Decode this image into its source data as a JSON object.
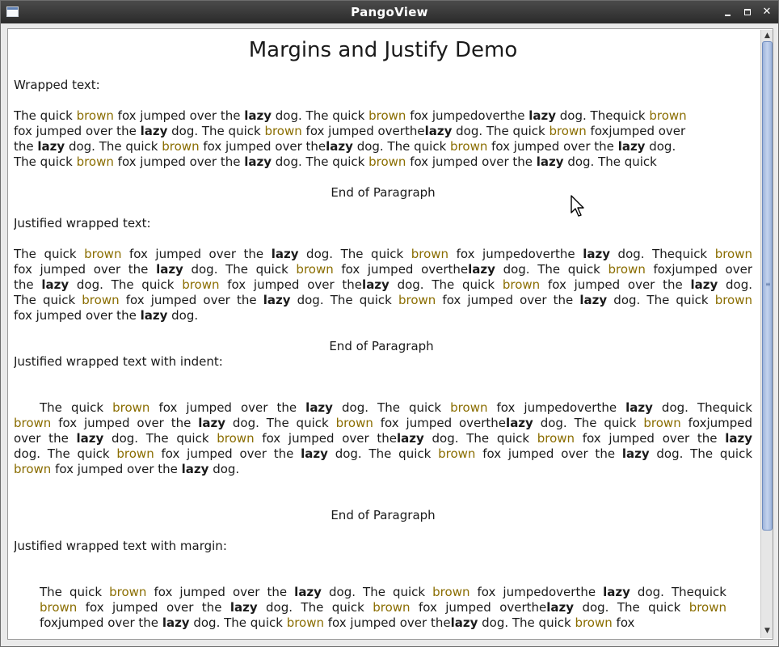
{
  "window": {
    "title": "PangoView",
    "controls": {
      "minimize": "minimize",
      "maximize": "maximize",
      "close": "close"
    }
  },
  "document": {
    "title": "Margins and Justify Demo",
    "sections": [
      {
        "label": "Wrapped text:",
        "lines": [
          [
            "The quick ",
            "brown",
            " fox jumped over the ",
            "lazy",
            " dog. The quick ",
            "brown",
            " fox jumpedoverthe ",
            "lazy",
            " dog. Thequick ",
            "brown"
          ],
          [
            "fox jumped over the ",
            "lazy",
            " dog. The quick ",
            "brown",
            " fox jumped overthe",
            "lazy",
            " dog. The quick ",
            "brown",
            " foxjumped over"
          ],
          [
            "the ",
            "lazy",
            " dog. The quick ",
            "brown",
            " fox jumped over the",
            "lazy",
            " dog. The quick ",
            "brown",
            " fox jumped over the ",
            "lazy",
            " dog."
          ],
          [
            "The quick ",
            "brown",
            " fox jumped over the ",
            "lazy",
            " dog. The quick ",
            "brown",
            " fox jumped over the ",
            "lazy",
            " dog. The quick"
          ]
        ],
        "end": "End of Paragraph"
      },
      {
        "label": "Justified wrapped text:",
        "lines": [
          [
            "The quick ",
            "brown",
            " fox jumped over the ",
            "lazy",
            " dog. The quick ",
            "brown",
            " fox jumpedoverthe ",
            "lazy",
            " dog. Thequick ",
            "brown"
          ],
          [
            "fox jumped over the ",
            "lazy",
            " dog. The quick ",
            "brown",
            " fox jumped overthe",
            "lazy",
            " dog. The quick ",
            "brown",
            " foxjumped over"
          ],
          [
            "the ",
            "lazy",
            " dog. The quick ",
            "brown",
            " fox jumped over the",
            "lazy",
            " dog. The quick ",
            "brown",
            " fox jumped over the ",
            "lazy",
            " dog."
          ],
          [
            "The quick ",
            "brown",
            " fox jumped over the ",
            "lazy",
            " dog. The quick ",
            "brown",
            " fox jumped over the ",
            "lazy",
            " dog. The quick ",
            "brown"
          ],
          [
            "fox jumped over the ",
            "lazy",
            " dog."
          ]
        ],
        "end": "End of Paragraph"
      },
      {
        "label": "Justified wrapped text with indent:",
        "lines": [
          [
            "The quick ",
            "brown",
            " fox jumped over the ",
            "lazy",
            " dog. The quick ",
            "brown",
            " fox jumpedoverthe ",
            "lazy",
            " dog. Thequick"
          ],
          [
            "brown",
            " fox jumped over the ",
            "lazy",
            " dog. The quick ",
            "brown",
            " fox jumped overthe",
            "lazy",
            " dog. The quick ",
            "brown",
            " foxjumped"
          ],
          [
            "over the ",
            "lazy",
            " dog. The quick ",
            "brown",
            " fox jumped over the",
            "lazy",
            " dog. The quick ",
            "brown",
            " fox jumped over the ",
            "lazy"
          ],
          [
            "dog. The quick ",
            "brown",
            " fox jumped over the ",
            "lazy",
            " dog. The quick ",
            "brown",
            " fox jumped over the ",
            "lazy",
            " dog. The quick"
          ],
          [
            "brown",
            " fox jumped over the ",
            "lazy",
            " dog."
          ]
        ],
        "end": "End of Paragraph"
      },
      {
        "label": "Justified wrapped text with margin:",
        "lines": [
          [
            "The quick ",
            "brown",
            " fox jumped over the ",
            "lazy",
            " dog. The quick ",
            "brown",
            " fox jumpedoverthe ",
            "lazy",
            " dog. Thequick"
          ],
          [
            "brown",
            " fox jumped over the ",
            "lazy",
            " dog. The quick ",
            "brown",
            " fox jumped overthe",
            "lazy",
            " dog. The quick ",
            "brown"
          ],
          [
            "foxjumped over the ",
            "lazy",
            " dog. The quick ",
            "brown",
            " fox jumped over the",
            "lazy",
            " dog. The quick ",
            "brown",
            " fox"
          ]
        ]
      }
    ]
  },
  "colors": {
    "brown": "#8a6d00",
    "text": "#1a1a1a",
    "titlebar": "#2f2f2f",
    "scroll_thumb": "#aec2e6"
  },
  "scrollbar": {
    "up_icon": "arrow-up-icon",
    "down_icon": "arrow-down-icon"
  }
}
